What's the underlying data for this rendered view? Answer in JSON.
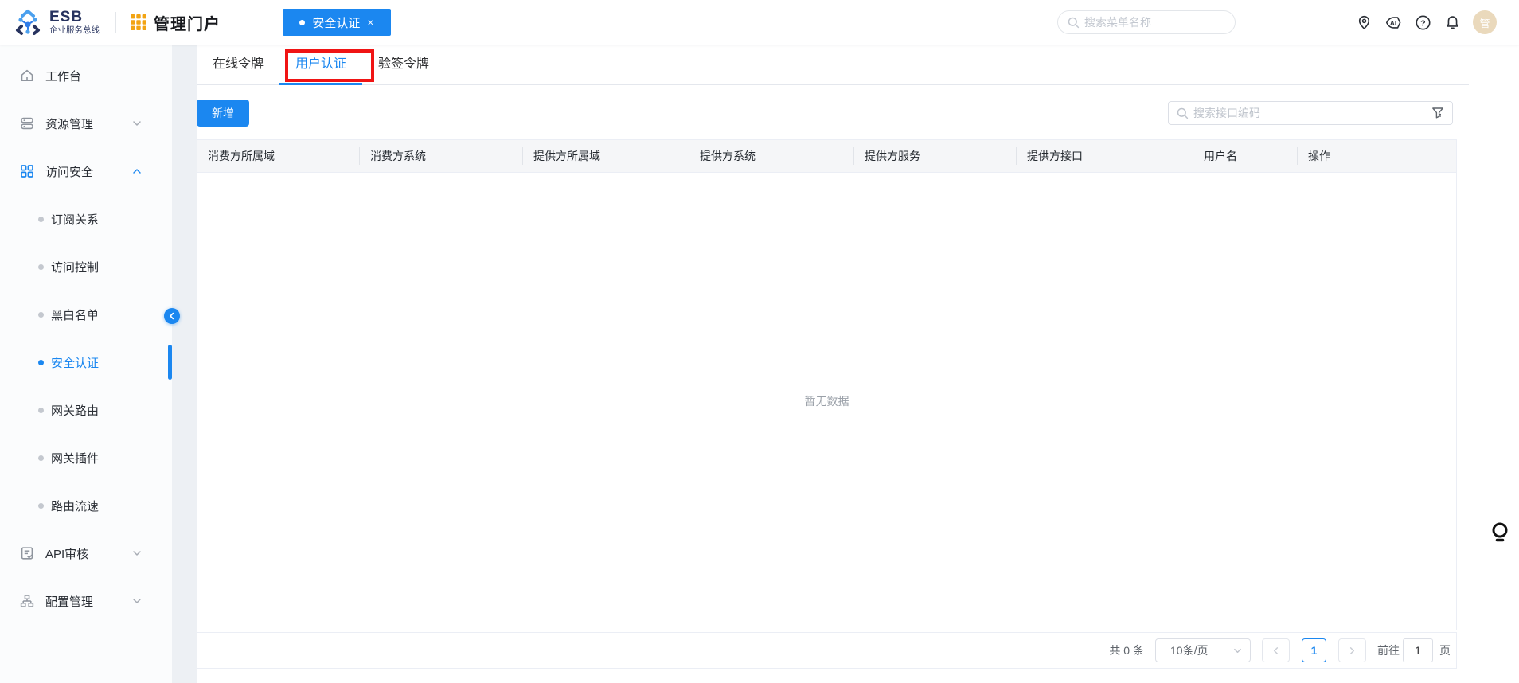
{
  "colors": {
    "accent": "#1b87f0",
    "annotation_red": "#f01414",
    "grid_amber": "#f2a413",
    "logo_navy": "#27335f",
    "avatar_bg": "#ead9bc",
    "active_item_bg": "#dcecfc"
  },
  "topbar": {
    "logo_title": "ESB",
    "logo_subtitle": "企业服务总线",
    "portal_title": "管理门户",
    "open_tab": {
      "label": "安全认证",
      "close": "×"
    },
    "search_placeholder": "搜索菜单名称",
    "avatar_text": "管"
  },
  "sidebar": {
    "items": [
      {
        "label": "工作台",
        "icon": "home-icon",
        "type": "parent"
      },
      {
        "label": "资源管理",
        "icon": "server-stack-icon",
        "type": "parent",
        "chevron": "down"
      },
      {
        "label": "访问安全",
        "icon": "grid-icon",
        "type": "parent",
        "chevron": "up",
        "expanded": true
      },
      {
        "label": "订阅关系",
        "type": "sub"
      },
      {
        "label": "访问控制",
        "type": "sub"
      },
      {
        "label": "黑白名单",
        "type": "sub"
      },
      {
        "label": "安全认证",
        "type": "sub",
        "active": true
      },
      {
        "label": "网关路由",
        "type": "sub"
      },
      {
        "label": "网关插件",
        "type": "sub"
      },
      {
        "label": "路由流速",
        "type": "sub"
      },
      {
        "label": "API审核",
        "icon": "clipboard-check-icon",
        "type": "parent",
        "chevron": "down"
      },
      {
        "label": "配置管理",
        "icon": "sitemap-icon",
        "type": "parent",
        "chevron": "down"
      }
    ]
  },
  "content": {
    "tabs": [
      {
        "label": "在线令牌"
      },
      {
        "label": "用户认证",
        "active": true,
        "annotated": true
      },
      {
        "label": "验签令牌"
      }
    ],
    "add_button": "新增",
    "search_placeholder": "搜索接口编码",
    "table": {
      "columns": [
        "消费方所属域",
        "消费方系统",
        "提供方所属域",
        "提供方系统",
        "提供方服务",
        "提供方接口",
        "用户名",
        "操作"
      ],
      "empty_text": "暂无数据"
    },
    "pagination": {
      "total": "共 0 条",
      "page_size": "10条/页",
      "current_page": "1",
      "goto_label": "前往",
      "goto_value": "1",
      "unit_label": "页"
    }
  }
}
